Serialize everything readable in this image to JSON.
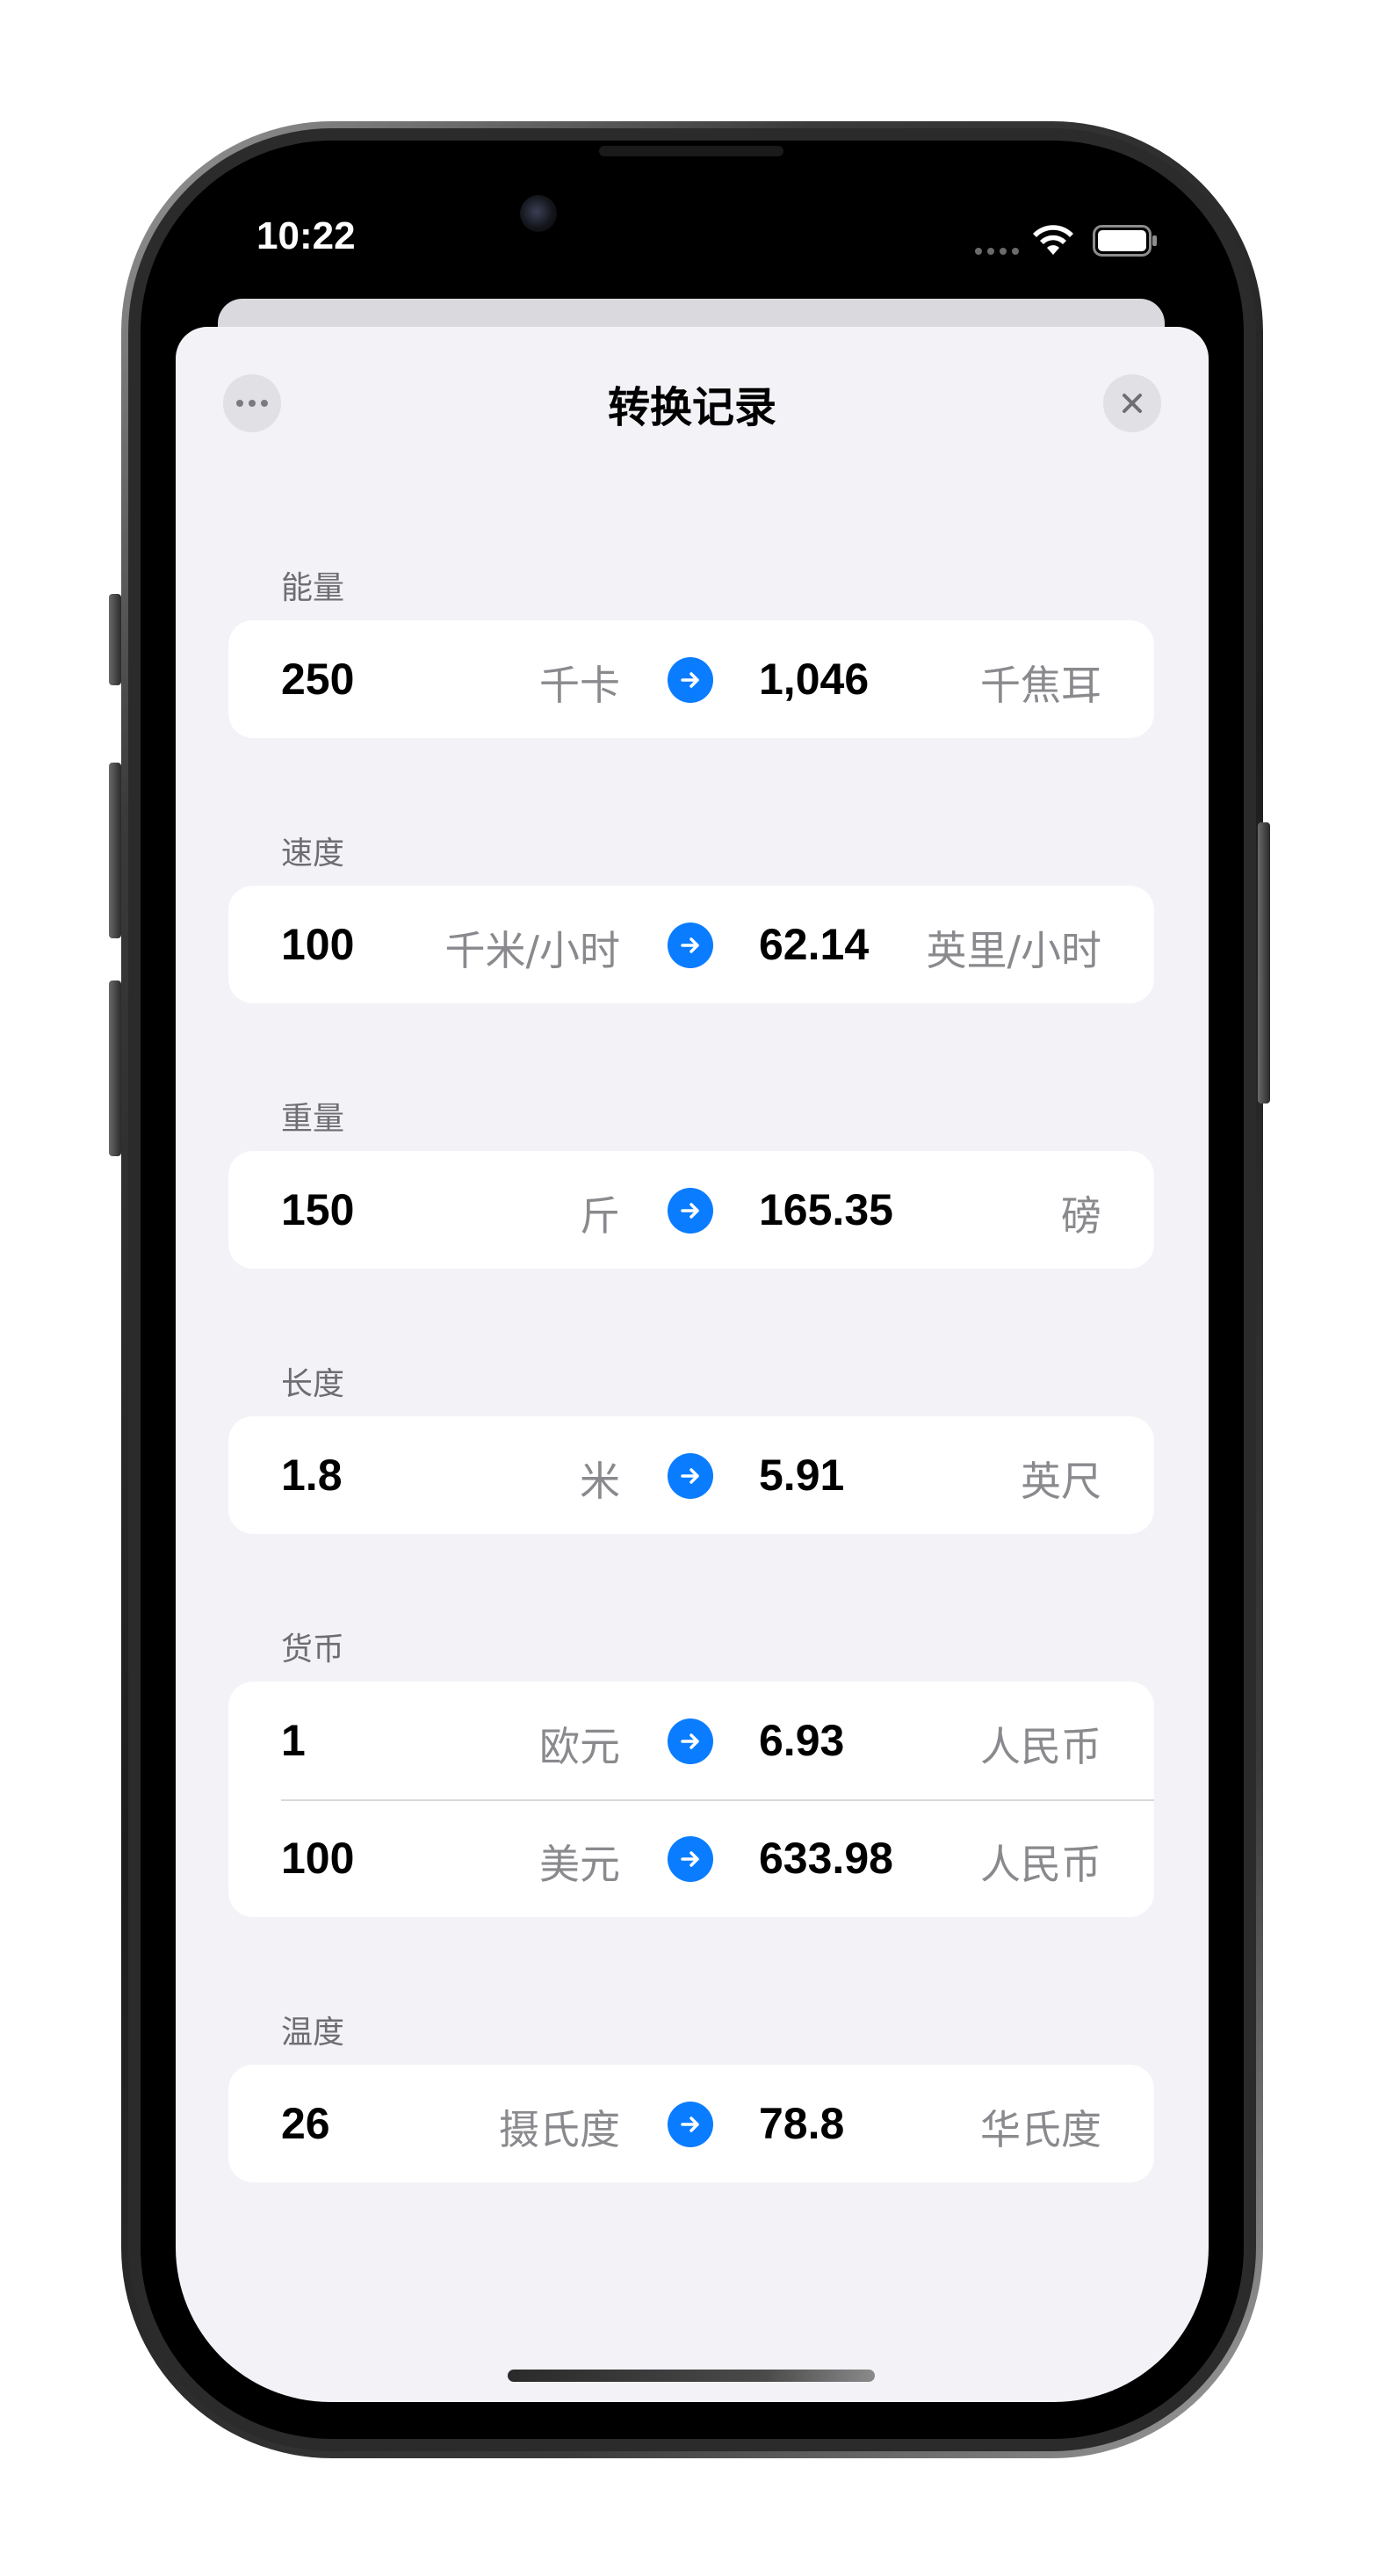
{
  "status_bar": {
    "time": "10:22"
  },
  "sheet": {
    "title": "转换记录"
  },
  "sections": [
    {
      "label": "能量",
      "rows": [
        {
          "from_value": "250",
          "from_unit": "千卡",
          "to_value": "1,046",
          "to_unit": "千焦耳"
        }
      ]
    },
    {
      "label": "速度",
      "rows": [
        {
          "from_value": "100",
          "from_unit": "千米/小时",
          "to_value": "62.14",
          "to_unit": "英里/小时"
        }
      ]
    },
    {
      "label": "重量",
      "rows": [
        {
          "from_value": "150",
          "from_unit": "斤",
          "to_value": "165.35",
          "to_unit": "磅"
        }
      ]
    },
    {
      "label": "长度",
      "rows": [
        {
          "from_value": "1.8",
          "from_unit": "米",
          "to_value": "5.91",
          "to_unit": "英尺"
        }
      ]
    },
    {
      "label": "货币",
      "rows": [
        {
          "from_value": "1",
          "from_unit": "欧元",
          "to_value": "6.93",
          "to_unit": "人民币"
        },
        {
          "from_value": "100",
          "from_unit": "美元",
          "to_value": "633.98",
          "to_unit": "人民币"
        }
      ]
    },
    {
      "label": "温度",
      "rows": [
        {
          "from_value": "26",
          "from_unit": "摄氏度",
          "to_value": "78.8",
          "to_unit": "华氏度"
        }
      ]
    }
  ],
  "icons": {
    "more": "ellipsis-icon",
    "close": "close-icon",
    "arrow": "arrow-right-circle-icon",
    "wifi": "wifi-icon",
    "battery": "battery-icon"
  },
  "colors": {
    "accent": "#0a7cff",
    "sheet_background": "#f2f2f7",
    "card_background": "#ffffff",
    "secondary_text": "#8a8a8e"
  }
}
